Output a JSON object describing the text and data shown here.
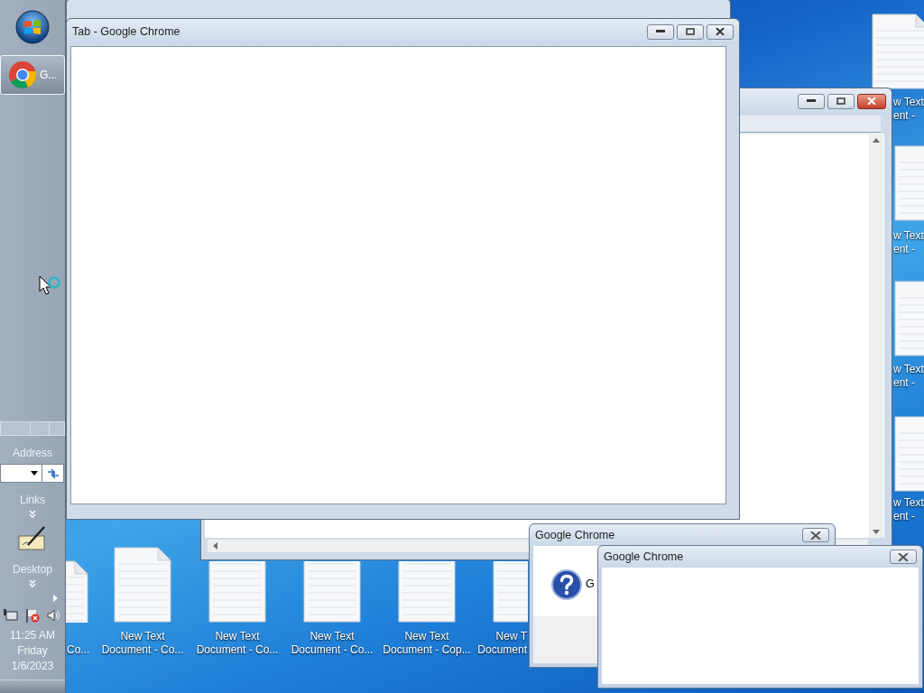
{
  "taskbar": {
    "buttons": [
      {
        "label": "G...",
        "selected": true
      }
    ],
    "address_label": "Address",
    "links_label": "Links",
    "desktop_label": "Desktop",
    "clock": {
      "time": "11:25 AM",
      "day": "Friday",
      "date": "1/6/2023"
    }
  },
  "desktop_icons": [
    {
      "label": [
        "w Text",
        "ent -"
      ]
    },
    {
      "label": [
        "w Text",
        "ent -"
      ]
    },
    {
      "label": [
        "w Text",
        "ent -"
      ]
    },
    {
      "label": [
        "w Text",
        "ent -"
      ]
    },
    {
      "label": [
        "Co..."
      ]
    },
    {
      "label": [
        "New Text",
        "Document - Co..."
      ]
    },
    {
      "label": [
        "New Text",
        "Document - Co..."
      ]
    },
    {
      "label": [
        "New Text",
        "Document - Co..."
      ]
    },
    {
      "label": [
        "New Text",
        "Document - Cop..."
      ]
    },
    {
      "label": [
        "New T",
        "Document"
      ]
    }
  ],
  "windows": [
    {
      "kind": "explorer"
    },
    {
      "kind": "browser",
      "title": "Tab - Google Chrome"
    },
    {
      "kind": "dialog",
      "title": "Google Chrome",
      "message": "G"
    },
    {
      "kind": "dialog",
      "title": "Google Chrome"
    }
  ]
}
